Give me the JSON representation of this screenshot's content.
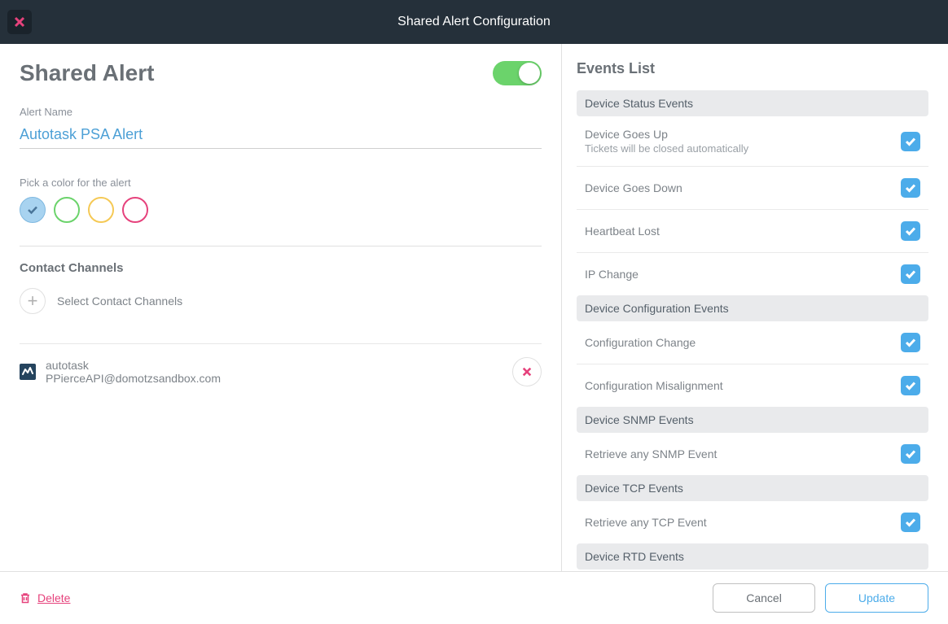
{
  "header": {
    "title": "Shared Alert Configuration"
  },
  "left": {
    "pageTitle": "Shared Alert",
    "alertNameLabel": "Alert Name",
    "alertNameValue": "Autotask PSA Alert",
    "colorLabel": "Pick a color for the alert",
    "colors": [
      "blue",
      "green",
      "yellow",
      "pink"
    ],
    "selectedColor": "blue",
    "contactChannels": {
      "title": "Contact Channels",
      "selectText": "Select Contact Channels",
      "contacts": [
        {
          "name": "autotask",
          "email": "PPierceAPI@domotzsandbox.com"
        }
      ]
    }
  },
  "right": {
    "title": "Events List",
    "groups": [
      {
        "header": "Device Status Events",
        "events": [
          {
            "label": "Device Goes Up",
            "sub": "Tickets will be closed automatically",
            "checked": true
          },
          {
            "label": "Device Goes Down",
            "checked": true
          },
          {
            "label": "Heartbeat Lost",
            "checked": true
          },
          {
            "label": "IP Change",
            "checked": true
          }
        ]
      },
      {
        "header": "Device Configuration Events",
        "events": [
          {
            "label": "Configuration Change",
            "checked": true
          },
          {
            "label": "Configuration Misalignment",
            "checked": true
          }
        ]
      },
      {
        "header": "Device SNMP Events",
        "events": [
          {
            "label": "Retrieve any SNMP Event",
            "checked": true
          }
        ]
      },
      {
        "header": "Device TCP Events",
        "events": [
          {
            "label": "Retrieve any TCP Event",
            "checked": true
          }
        ]
      },
      {
        "header": "Device RTD Events",
        "events": []
      }
    ]
  },
  "footer": {
    "delete": "Delete",
    "cancel": "Cancel",
    "update": "Update"
  }
}
